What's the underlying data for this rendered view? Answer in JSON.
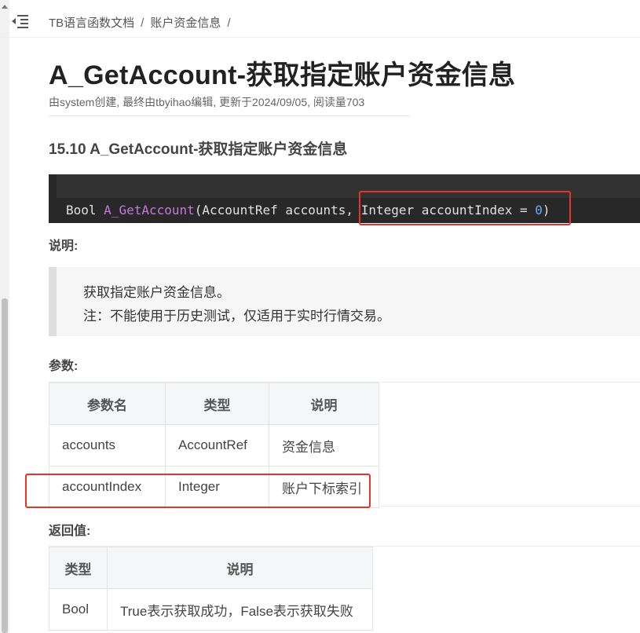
{
  "breadcrumb": {
    "root": "TB语言函数文档",
    "sep1": "/",
    "current": "账户资金信息",
    "sep2": "/"
  },
  "page": {
    "title": "A_GetAccount-获取指定账户资金信息",
    "meta": "由system创建, 最终由tbyihao编辑, 更新于2024/09/05, 阅读量703"
  },
  "section": {
    "title": "15.10 A_GetAccount-获取指定账户资金信息"
  },
  "code": {
    "return_type": "Bool ",
    "fn_name": "A_GetAccount",
    "args_part1": "(AccountRef accounts, ",
    "args_part2": "Integer accountIndex = ",
    "default_value": "0",
    "close": ")"
  },
  "description": {
    "label": "说明:",
    "line1": "获取指定账户资金信息。",
    "line2": "注：不能使用于历史测试，仅适用于实时行情交易。"
  },
  "params": {
    "label": "参数:",
    "headers": [
      "参数名",
      "类型",
      "说明"
    ],
    "rows": [
      [
        "accounts",
        "AccountRef",
        "资金信息"
      ],
      [
        "accountIndex",
        "Integer",
        "账户下标索引"
      ]
    ]
  },
  "returns": {
    "label": "返回值:",
    "headers": [
      "类型",
      "说明"
    ],
    "rows": [
      [
        "Bool",
        "True表示获取成功，False表示获取失败"
      ]
    ]
  },
  "colors": {
    "highlight": "#e8332a",
    "code_bg": "#282828",
    "fn_color": "#c678dd",
    "number_color": "#61afef"
  },
  "icons": {
    "toc_toggle": "outdent-list-icon"
  }
}
